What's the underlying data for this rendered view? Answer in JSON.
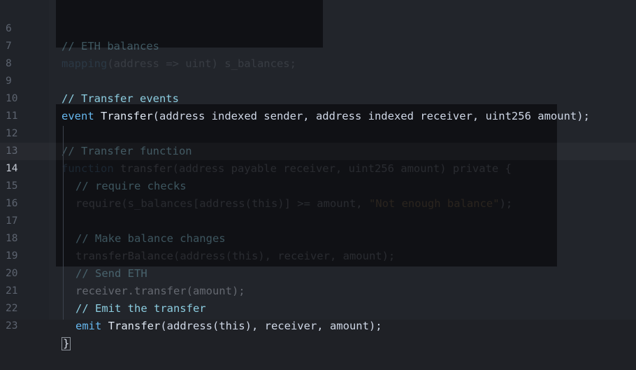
{
  "gutter": {
    "lines": [
      "6",
      "7",
      "8",
      "9",
      "10",
      "11",
      "12",
      "13",
      "14",
      "15",
      "16",
      "17",
      "18",
      "19",
      "20",
      "21",
      "22",
      "23"
    ]
  },
  "code": {
    "l6": "// ETH balances",
    "l7_a": "mapping",
    "l7_b": "(address => uint) s_balances;",
    "l9": "// Transfer events",
    "l10_a": "event",
    "l10_b": "Transfer",
    "l10_c": "(address indexed sender, address indexed receiver, uint256 amount);",
    "l12": "// Transfer function",
    "l13_a": "function",
    "l13_b": "transfer",
    "l13_c": "(address payable receiver, uint256 amount) private {",
    "l14": "// require checks",
    "l15_a": "require",
    "l15_b": "(s_balances[address(this)] >= amount, ",
    "l15_c": "\"Not enough balance\"",
    "l15_d": ");",
    "l17": "// Make balance changes",
    "l18_a": "transferBalance",
    "l18_b": "(address(this), receiver, amount);",
    "l19": "// Send ETH",
    "l20": "receiver.transfer(amount);",
    "l21": "// Emit the transfer",
    "l22_a": "emit",
    "l22_b": "Transfer",
    "l22_c": "(address(this), receiver, amount);",
    "l23": "}"
  }
}
